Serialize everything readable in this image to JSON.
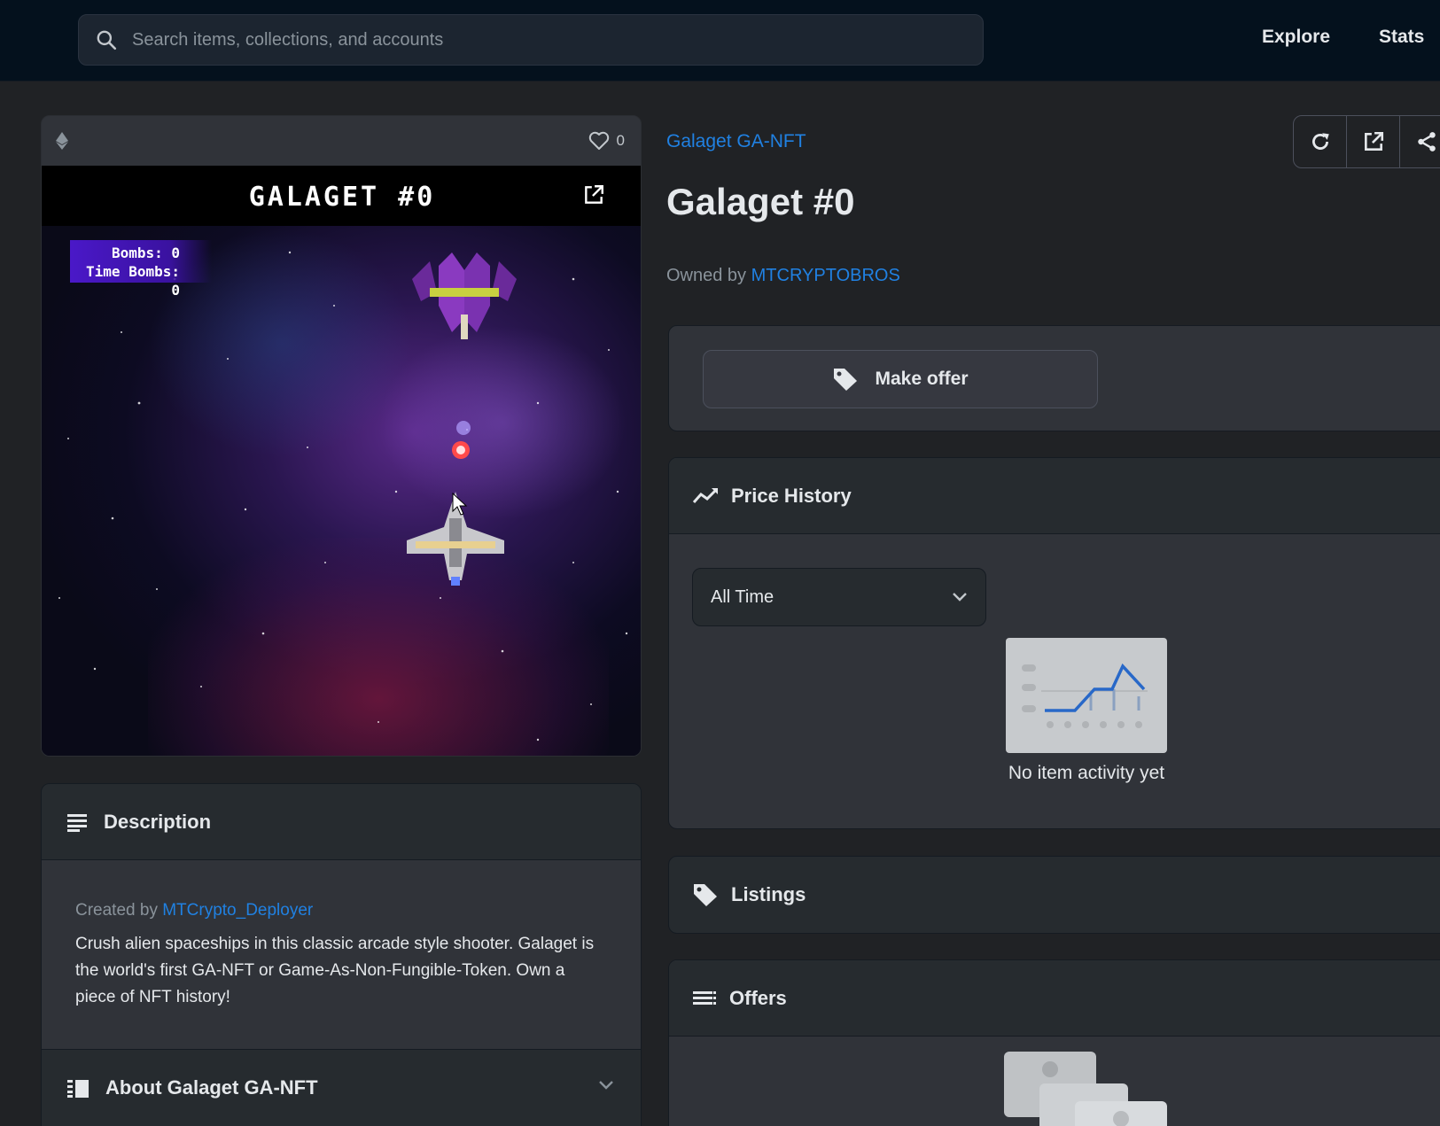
{
  "header": {
    "search_placeholder": "Search items, collections, and accounts",
    "nav": [
      "Explore",
      "Stats"
    ]
  },
  "media": {
    "favorites_count": "0",
    "game_title": "GALAGET #0",
    "hud_bombs": "Bombs: 0",
    "hud_time_bombs": "Time Bombs: 0"
  },
  "description": {
    "heading": "Description",
    "created_prefix": "Created by",
    "creator": "MTCrypto_Deployer",
    "text": "Crush alien spaceships in this classic arcade style shooter. Galaget is the world's first GA-NFT or Game-As-Non-Fungible-Token. Own a piece of NFT history!",
    "about_heading": "About Galaget GA-NFT"
  },
  "item": {
    "collection": "Galaget GA-NFT",
    "title": "Galaget #0",
    "owned_prefix": "Owned by",
    "owner": "MTCRYPTOBROS"
  },
  "offer": {
    "make_offer_label": "Make offer"
  },
  "price_history": {
    "heading": "Price History",
    "range_selected": "All Time",
    "empty_text": "No item activity yet"
  },
  "listings": {
    "heading": "Listings"
  },
  "offers": {
    "heading": "Offers"
  },
  "colors": {
    "accent": "#2081e2",
    "background": "#202225",
    "header_bg": "#04111d",
    "card_bg": "#303339"
  }
}
